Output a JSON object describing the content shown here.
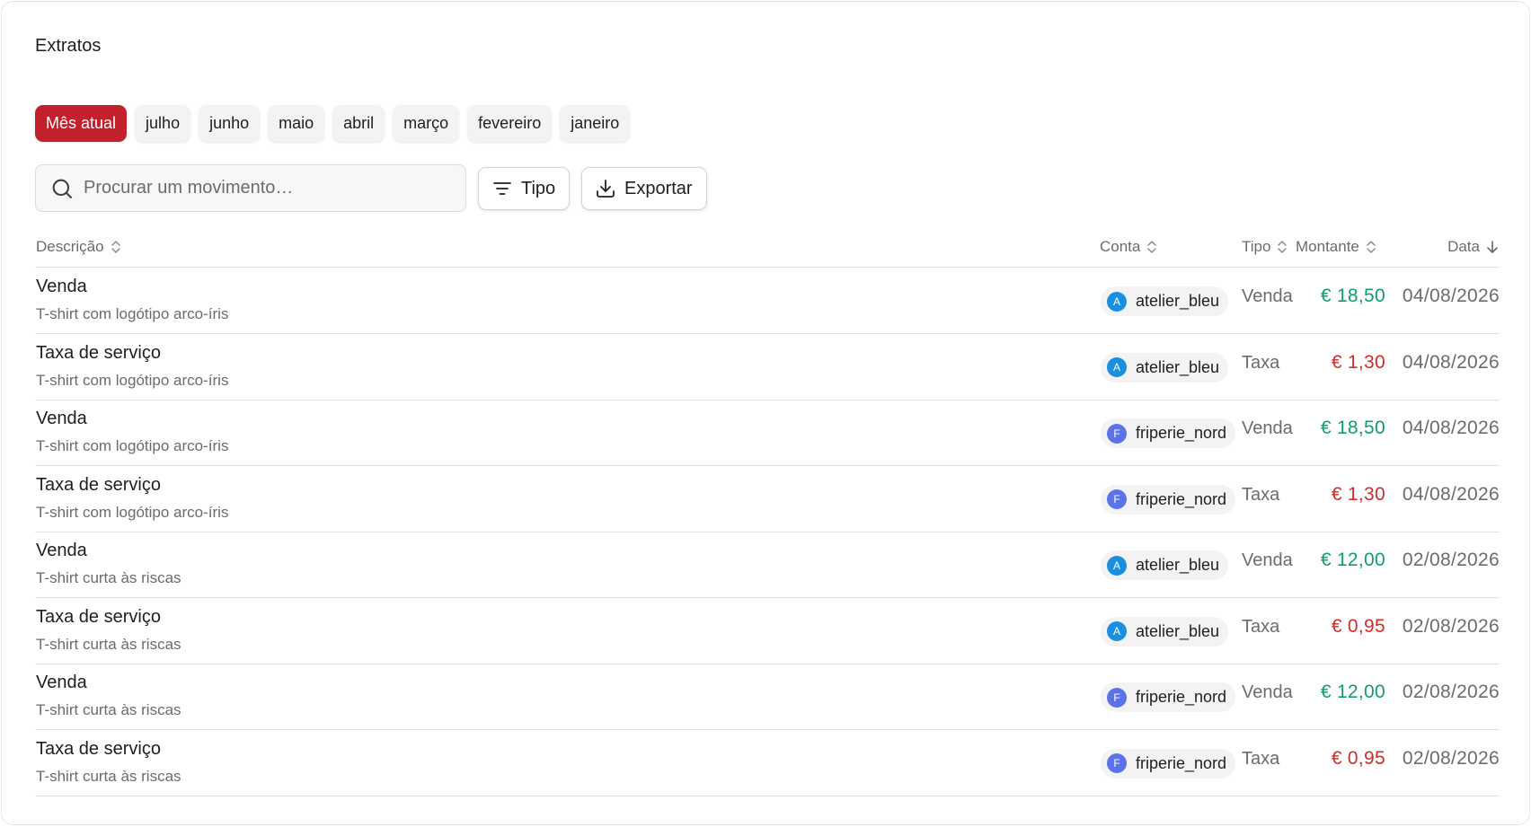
{
  "page": {
    "title": "Extratos"
  },
  "months": [
    "Mês atual",
    "julho",
    "junho",
    "maio",
    "abril",
    "março",
    "fevereiro",
    "janeiro"
  ],
  "toolbar": {
    "search_placeholder": "Procurar um movimento…",
    "filter_label": "Tipo",
    "export_label": "Exportar"
  },
  "table": {
    "headers": {
      "descricao": "Descrição",
      "conta": "Conta",
      "tipo": "Tipo",
      "montante": "Montante",
      "data": "Data"
    },
    "rows": [
      {
        "title": "Venda",
        "subtitle": "T-shirt com logótipo arco-íris",
        "avatar": "A",
        "account": "atelier_bleu",
        "tipo": "Venda",
        "amount": "€ 18,50",
        "kind": "credit",
        "date": "04/08/2026"
      },
      {
        "title": "Taxa de serviço",
        "subtitle": "T-shirt com logótipo arco-íris",
        "avatar": "A",
        "account": "atelier_bleu",
        "tipo": "Taxa",
        "amount": "€ 1,30",
        "kind": "debit",
        "date": "04/08/2026"
      },
      {
        "title": "Venda",
        "subtitle": "T-shirt com logótipo arco-íris",
        "avatar": "F",
        "account": "friperie_nord",
        "tipo": "Venda",
        "amount": "€ 18,50",
        "kind": "credit",
        "date": "04/08/2026"
      },
      {
        "title": "Taxa de serviço",
        "subtitle": "T-shirt com logótipo arco-íris",
        "avatar": "F",
        "account": "friperie_nord",
        "tipo": "Taxa",
        "amount": "€ 1,30",
        "kind": "debit",
        "date": "04/08/2026"
      },
      {
        "title": "Venda",
        "subtitle": "T-shirt curta às riscas",
        "avatar": "A",
        "account": "atelier_bleu",
        "tipo": "Venda",
        "amount": "€ 12,00",
        "kind": "credit",
        "date": "02/08/2026"
      },
      {
        "title": "Taxa de serviço",
        "subtitle": "T-shirt curta às riscas",
        "avatar": "A",
        "account": "atelier_bleu",
        "tipo": "Taxa",
        "amount": "€ 0,95",
        "kind": "debit",
        "date": "02/08/2026"
      },
      {
        "title": "Venda",
        "subtitle": "T-shirt curta às riscas",
        "avatar": "F",
        "account": "friperie_nord",
        "tipo": "Venda",
        "amount": "€ 12,00",
        "kind": "credit",
        "date": "02/08/2026"
      },
      {
        "title": "Taxa de serviço",
        "subtitle": "T-shirt curta às riscas",
        "avatar": "F",
        "account": "friperie_nord",
        "tipo": "Taxa",
        "amount": "€ 0,95",
        "kind": "debit",
        "date": "02/08/2026"
      }
    ]
  },
  "colors": {
    "accent": "#c1202c",
    "credit": "#0f9d6b",
    "debit": "#d42a2a",
    "avatar_atelier": "#1a8fe0",
    "avatar_friperie": "#5b73e8"
  },
  "icons": {
    "search": "search-icon",
    "filter": "filter-icon",
    "export": "download-icon",
    "sort": "sort-updown-icon",
    "sort_desc": "arrow-down-icon"
  }
}
